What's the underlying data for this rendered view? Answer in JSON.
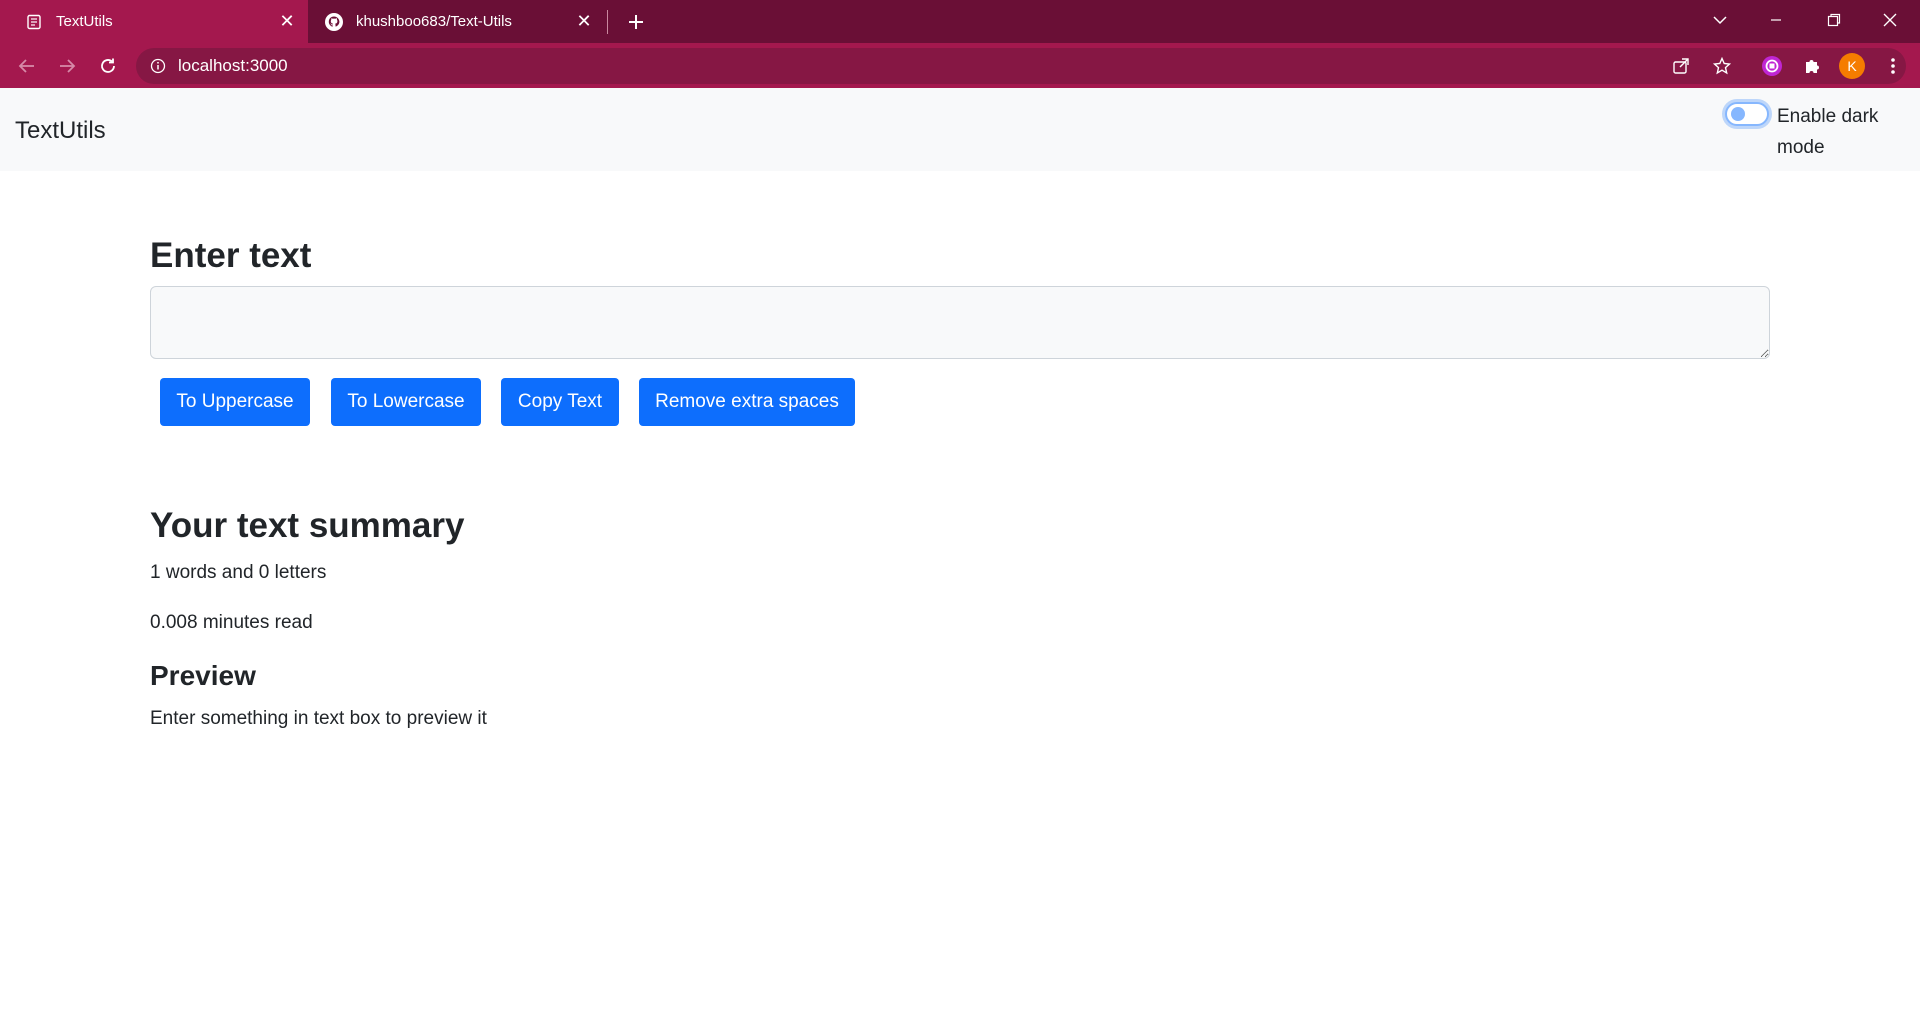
{
  "browser": {
    "tabs": [
      {
        "title": "TextUtils",
        "favicon": "page-icon",
        "active": true
      },
      {
        "title": "khushboo683/Text-Utils",
        "favicon": "github-icon",
        "active": false
      }
    ],
    "url": "localhost:3000",
    "profile_initial": "K",
    "colors": {
      "tabbar": "#6a0f36",
      "active_tab": "#a4184e",
      "omnibox": "#861744",
      "profile": "#f57c00"
    }
  },
  "navbar": {
    "brand": "TextUtils",
    "dark_mode_label": "Enable dark mode",
    "dark_mode_enabled": false
  },
  "form": {
    "heading": "Enter text",
    "textarea_value": "",
    "buttons": {
      "uppercase": "To Uppercase",
      "lowercase": "To Lowercase",
      "copy": "Copy Text",
      "remove_spaces": "Remove extra spaces"
    },
    "button_color": "#0d6efd"
  },
  "summary": {
    "heading": "Your text summary",
    "counts": "1 words and 0 letters",
    "read_time": "0.008 minutes read",
    "preview_heading": "Preview",
    "preview_text": "Enter something in text box to preview it"
  }
}
